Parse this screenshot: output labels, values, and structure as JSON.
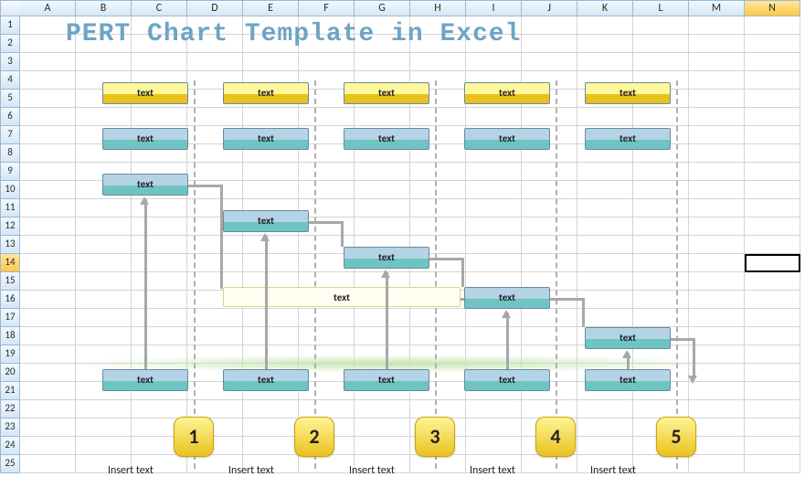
{
  "cols": [
    "A",
    "B",
    "C",
    "D",
    "E",
    "F",
    "G",
    "H",
    "I",
    "J",
    "K",
    "L",
    "M",
    "N"
  ],
  "rows": [
    "1",
    "2",
    "3",
    "4",
    "5",
    "6",
    "7",
    "8",
    "9",
    "10",
    "11",
    "12",
    "13",
    "14",
    "15",
    "16",
    "17",
    "18",
    "19",
    "20",
    "21",
    "22",
    "23",
    "24",
    "25"
  ],
  "sel_col": "N",
  "sel_row": "14",
  "title": "PERT Chart Template in Excel",
  "text_label": "text",
  "pale_label": "text",
  "numbers": [
    "1",
    "2",
    "3",
    "4",
    "5"
  ],
  "caption": "Insert text",
  "chart_data": {
    "type": "PERT-diagram",
    "lanes": 5,
    "lane_numbers": [
      1,
      2,
      3,
      4,
      5
    ],
    "lane_captions": [
      "Insert text",
      "Insert text",
      "Insert text",
      "Insert text",
      "Insert text"
    ],
    "row_top_yellow": [
      "text",
      "text",
      "text",
      "text",
      "text"
    ],
    "row_top_blue": [
      "text",
      "text",
      "text",
      "text",
      "text"
    ],
    "staircase_nodes": [
      "text",
      "text",
      "text",
      "text",
      "text"
    ],
    "wide_annotation": "text",
    "row_bottom_blue": [
      "text",
      "text",
      "text",
      "text",
      "text"
    ],
    "connectors": "staircase left-to-right with vertical drops per lane and upward arrows from bottom row"
  }
}
